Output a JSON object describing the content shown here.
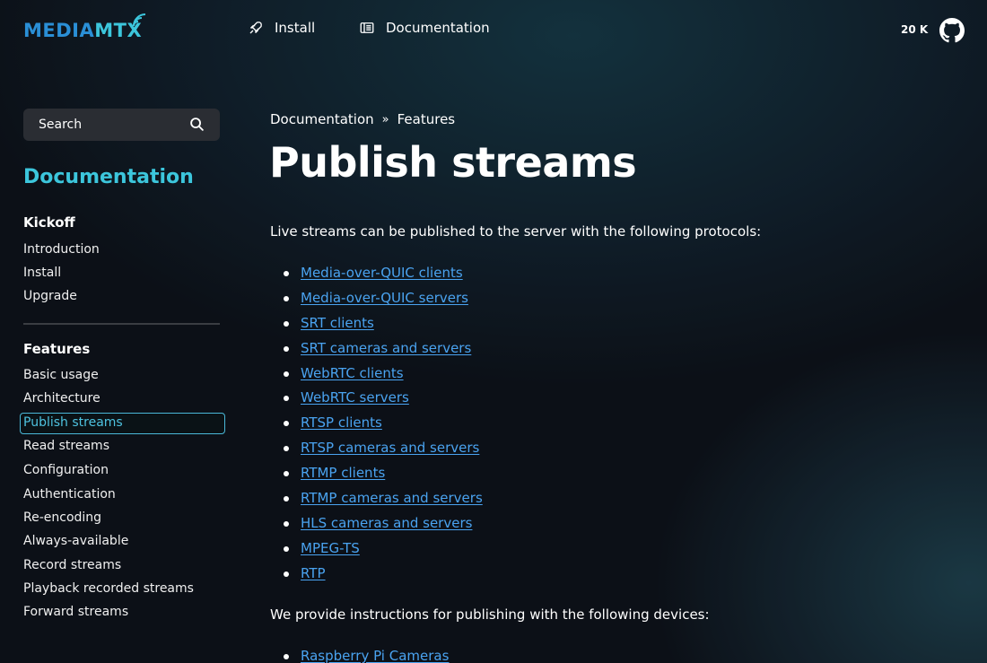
{
  "header": {
    "logo_part1": "MEDIA",
    "logo_part2": "MTX",
    "nav": [
      {
        "label": "Install",
        "icon": "rocket-icon"
      },
      {
        "label": "Documentation",
        "icon": "book-icon"
      }
    ],
    "stars": "20 K",
    "github_icon": "github-icon"
  },
  "sidebar": {
    "search_label": "Search",
    "title": "Documentation",
    "sections": [
      {
        "heading": "Kickoff",
        "items": [
          "Introduction",
          "Install",
          "Upgrade"
        ]
      },
      {
        "heading": "Features",
        "items": [
          "Basic usage",
          "Architecture",
          "Publish streams",
          "Read streams",
          "Configuration",
          "Authentication",
          "Re-encoding",
          "Always-available",
          "Record streams",
          "Playback recorded streams",
          "Forward streams"
        ]
      }
    ],
    "active_item": "Publish streams"
  },
  "main": {
    "breadcrumb": [
      "Documentation",
      "»",
      "Features"
    ],
    "title": "Publish streams",
    "intro": "Live streams can be published to the server with the following protocols:",
    "protocols": [
      "Media-over-QUIC clients",
      "Media-over-QUIC servers",
      "SRT clients",
      "SRT cameras and servers",
      "WebRTC clients",
      "WebRTC servers",
      "RTSP clients",
      "RTSP cameras and servers",
      "RTMP clients",
      "RTMP cameras and servers",
      "HLS cameras and servers",
      "MPEG-TS",
      "RTP"
    ],
    "devices_intro": "We provide instructions for publishing with the following devices:",
    "devices": [
      "Raspberry Pi Cameras"
    ]
  },
  "colors": {
    "accent": "#3cc6dc",
    "link": "#4aa3f0",
    "logo_blue": "#2a8fd6"
  }
}
